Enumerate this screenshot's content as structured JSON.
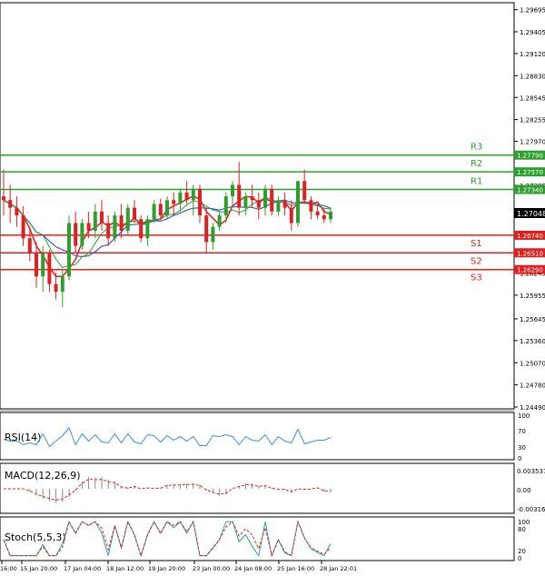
{
  "price_axis": {
    "ticks": [
      "1.29695",
      "1.29405",
      "1.29120",
      "1.28830",
      "1.28545",
      "1.28255",
      "1.27970",
      "1.27680",
      "1.27395",
      "1.27105",
      "1.26820",
      "1.26535",
      "1.26245",
      "1.25955",
      "1.25670",
      "1.25380",
      "1.25095",
      "1.24805",
      "1.24520",
      "1.24230"
    ],
    "visible_ticks": [
      "1.29695",
      "1.29405",
      "1.29120",
      "1.28830",
      "1.28545",
      "1.28255",
      "1.27970",
      "1.27395",
      "1.26245",
      "1.25955",
      "1.25645",
      "1.25360",
      "1.25070",
      "1.24780",
      "1.24490"
    ],
    "current_price": "1.27048"
  },
  "levels": [
    {
      "name": "R3",
      "price": "1.27790",
      "value": 1.2779,
      "color": "#2e9e2e"
    },
    {
      "name": "R2",
      "price": "1.27570",
      "value": 1.2757,
      "color": "#2e9e2e"
    },
    {
      "name": "R1",
      "price": "1.27340",
      "value": 1.2734,
      "color": "#2e9e2e"
    },
    {
      "name": "S1",
      "price": "1.26740",
      "value": 1.2674,
      "color": "#e02020"
    },
    {
      "name": "S2",
      "price": "1.26510",
      "value": 1.2651,
      "color": "#e02020"
    },
    {
      "name": "S3",
      "price": "1.26290",
      "value": 1.2629,
      "color": "#e02020"
    }
  ],
  "indicators": {
    "rsi": {
      "label": "RSI(14)",
      "ticks": [
        "100",
        "70",
        "30",
        "0"
      ]
    },
    "macd": {
      "label": "MACD(12,26,9)",
      "ticks": [
        "0.003537",
        "0.00",
        "-0.003165"
      ]
    },
    "stoch": {
      "label": "Stoch(5,5,3)",
      "ticks": [
        "100",
        "80",
        "20",
        "0"
      ]
    }
  },
  "time_axis": [
    "16:00",
    "15 Jan 20:00",
    "17 Jan 04:00",
    "18 Jan 12:00",
    "19 Jan 20:00",
    "23 Jan 00:00",
    "24 Jan 08:00",
    "25 Jan 16:00",
    "28 Jan 22:01"
  ],
  "colors": {
    "bull": "#2e9e2e",
    "bear": "#e02020",
    "ma_fast": "#e02020",
    "ma_slow": "#3a5bd9",
    "ma_mid": "#2e9e2e",
    "rsi": "#3a8fd9",
    "stoch_main": "#2aa0a8",
    "stoch_signal": "#e02020"
  },
  "chart_data": {
    "type": "candlestick",
    "ylim": [
      1.2449,
      1.2975
    ],
    "candles": [
      [
        1.2725,
        1.276,
        1.27,
        1.272
      ],
      [
        1.272,
        1.274,
        1.269,
        1.271
      ],
      [
        1.271,
        1.2725,
        1.2685,
        1.27
      ],
      [
        1.27,
        1.2712,
        1.266,
        1.267
      ],
      [
        1.267,
        1.2685,
        1.264,
        1.265
      ],
      [
        1.265,
        1.2665,
        1.2605,
        1.262
      ],
      [
        1.262,
        1.266,
        1.26,
        1.265
      ],
      [
        1.265,
        1.2655,
        1.26,
        1.261
      ],
      [
        1.261,
        1.2625,
        1.259,
        1.26
      ],
      [
        1.26,
        1.263,
        1.258,
        1.262
      ],
      [
        1.262,
        1.27,
        1.2615,
        1.269
      ],
      [
        1.269,
        1.2705,
        1.265,
        1.266
      ],
      [
        1.266,
        1.2695,
        1.2655,
        1.269
      ],
      [
        1.269,
        1.2705,
        1.267,
        1.268
      ],
      [
        1.268,
        1.2715,
        1.267,
        1.2705
      ],
      [
        1.2705,
        1.272,
        1.268,
        1.269
      ],
      [
        1.269,
        1.27,
        1.266,
        1.267
      ],
      [
        1.267,
        1.2705,
        1.2665,
        1.27
      ],
      [
        1.27,
        1.2715,
        1.267,
        1.268
      ],
      [
        1.268,
        1.2715,
        1.2675,
        1.271
      ],
      [
        1.271,
        1.272,
        1.269,
        1.2695
      ],
      [
        1.2695,
        1.27,
        1.2665,
        1.267
      ],
      [
        1.267,
        1.27,
        1.266,
        1.2695
      ],
      [
        1.2695,
        1.272,
        1.269,
        1.2715
      ],
      [
        1.2715,
        1.2722,
        1.2695,
        1.27
      ],
      [
        1.27,
        1.2725,
        1.2695,
        1.272
      ],
      [
        1.272,
        1.273,
        1.27,
        1.2715
      ],
      [
        1.2715,
        1.2735,
        1.2705,
        1.273
      ],
      [
        1.273,
        1.2745,
        1.2715,
        1.272
      ],
      [
        1.272,
        1.274,
        1.27,
        1.2735
      ],
      [
        1.2735,
        1.274,
        1.269,
        1.27
      ],
      [
        1.27,
        1.271,
        1.265,
        1.2665
      ],
      [
        1.2665,
        1.269,
        1.2655,
        1.2685
      ],
      [
        1.2685,
        1.2705,
        1.268,
        1.27
      ],
      [
        1.27,
        1.273,
        1.269,
        1.2725
      ],
      [
        1.2725,
        1.2745,
        1.271,
        1.274
      ],
      [
        1.274,
        1.277,
        1.27,
        1.271
      ],
      [
        1.271,
        1.273,
        1.27,
        1.2725
      ],
      [
        1.2725,
        1.274,
        1.271,
        1.272
      ],
      [
        1.272,
        1.273,
        1.2695,
        1.271
      ],
      [
        1.271,
        1.274,
        1.27,
        1.2735
      ],
      [
        1.2735,
        1.274,
        1.27,
        1.2705
      ],
      [
        1.2705,
        1.2725,
        1.27,
        1.272
      ],
      [
        1.272,
        1.273,
        1.27,
        1.271
      ],
      [
        1.271,
        1.272,
        1.268,
        1.269
      ],
      [
        1.269,
        1.274,
        1.2685,
        1.2745
      ],
      [
        1.2745,
        1.276,
        1.2715,
        1.272
      ],
      [
        1.272,
        1.2725,
        1.2695,
        1.2705
      ],
      [
        1.2705,
        1.2715,
        1.2695,
        1.27
      ],
      [
        1.27,
        1.271,
        1.269,
        1.2695
      ],
      [
        1.2695,
        1.271,
        1.269,
        1.2705
      ]
    ]
  }
}
